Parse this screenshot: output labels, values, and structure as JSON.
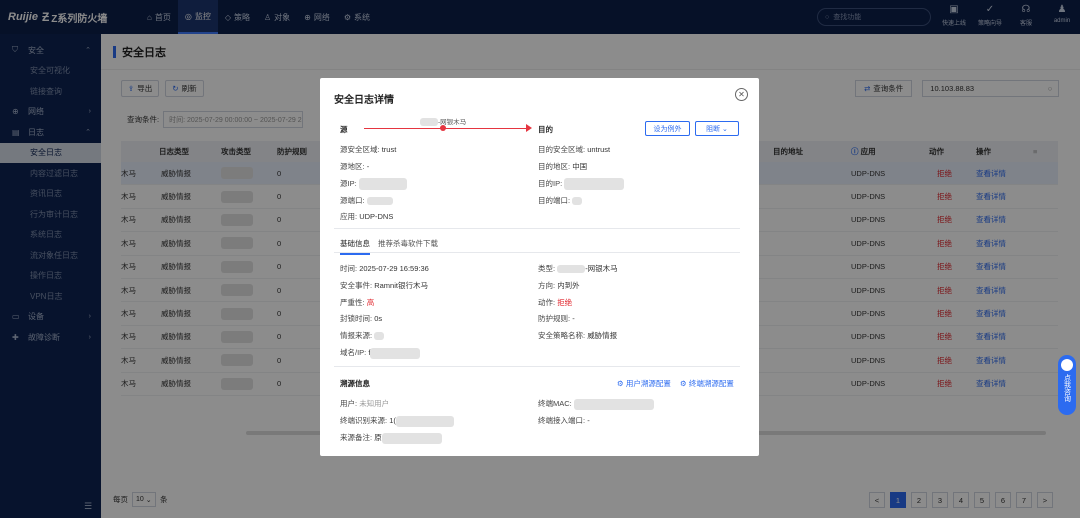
{
  "brand": {
    "logo": "Ruijie",
    "product": "Z系列防火墙"
  },
  "nav": [
    "首页",
    "监控",
    "策略",
    "对象",
    "网络",
    "系统"
  ],
  "search_placeholder": "查找功能",
  "tools": [
    "快速上线",
    "策略向导",
    "客服",
    "admin"
  ],
  "sidebar": {
    "groups": [
      {
        "label": "安全",
        "subs": [
          "安全可视化",
          "链接查询"
        ]
      },
      {
        "label": "网络"
      },
      {
        "label": "日志",
        "subs": [
          "安全日志",
          "内容过滤日志",
          "资讯日志",
          "行为审计日志",
          "系统日志",
          "流对象任日志",
          "操作日志",
          "VPN日志"
        ]
      },
      {
        "label": "设备"
      },
      {
        "label": "故障诊断"
      }
    ]
  },
  "page_title": "安全日志",
  "toolbar": {
    "export": "导出",
    "refresh": "刷新",
    "query": "查询条件",
    "ip": "10.103.88.83",
    "cond_label": "查询条件:",
    "cond_value": "时间: 2025-07-29 00:00:00 ~ 2025-07-29 23:59:59"
  },
  "table": {
    "headers": [
      "日志类型",
      "攻击类型",
      "防护规则",
      "目的地址",
      "应用",
      "动作",
      "操作"
    ],
    "rows": [
      {
        "prefix": "木马",
        "type": "威胁情报",
        "rule": "0",
        "app": "UDP-DNS",
        "action": "拒绝",
        "op": "查看详情"
      },
      {
        "prefix": "木马",
        "type": "威胁情报",
        "rule": "0",
        "app": "UDP-DNS",
        "action": "拒绝",
        "op": "查看详情"
      },
      {
        "prefix": "木马",
        "type": "威胁情报",
        "rule": "0",
        "app": "UDP-DNS",
        "action": "拒绝",
        "op": "查看详情"
      },
      {
        "prefix": "木马",
        "type": "威胁情报",
        "rule": "0",
        "app": "UDP-DNS",
        "action": "拒绝",
        "op": "查看详情"
      },
      {
        "prefix": "木马",
        "type": "威胁情报",
        "rule": "0",
        "app": "UDP-DNS",
        "action": "拒绝",
        "op": "查看详情"
      },
      {
        "prefix": "木马",
        "type": "威胁情报",
        "rule": "0",
        "app": "UDP-DNS",
        "action": "拒绝",
        "op": "查看详情"
      },
      {
        "prefix": "木马",
        "type": "威胁情报",
        "rule": "0",
        "app": "UDP-DNS",
        "action": "拒绝",
        "op": "查看详情"
      },
      {
        "prefix": "木马",
        "type": "威胁情报",
        "rule": "0",
        "app": "UDP-DNS",
        "action": "拒绝",
        "op": "查看详情"
      },
      {
        "prefix": "木马",
        "type": "威胁情报",
        "rule": "0",
        "app": "UDP-DNS",
        "action": "拒绝",
        "op": "查看详情"
      },
      {
        "prefix": "木马",
        "type": "威胁情报",
        "rule": "0",
        "app": "UDP-DNS",
        "action": "拒绝",
        "op": "查看详情"
      }
    ]
  },
  "pager": {
    "prefix": "每页",
    "size": "10",
    "suffix": "条",
    "pages": [
      "1",
      "2",
      "3",
      "4",
      "5",
      "6",
      "7"
    ],
    "prev": "<",
    "next": ">"
  },
  "help": "点我咨询",
  "modal": {
    "title": "安全日志详情",
    "src": "源",
    "dst": "目的",
    "flow_label": "-网银木马",
    "exclude_btn": "设为例外",
    "block_btn": "阻断 ⌄",
    "src_zone_k": "源安全区域:",
    "src_zone_v": "trust",
    "src_region_k": "源地区:",
    "src_region_v": "-",
    "src_ip_k": "源IP:",
    "src_port_k": "源端口:",
    "app_k": "应用:",
    "app_v": "UDP-DNS",
    "dst_zone_k": "目的安全区域:",
    "dst_zone_v": "untrust",
    "dst_region_k": "目的地区:",
    "dst_region_v": "中国",
    "dst_ip_k": "目的IP:",
    "dst_port_k": "目的端口:",
    "tab_basic": "基础信息",
    "tab_av": "推荐杀毒软件下载",
    "time_k": "时间:",
    "time_v": "2025-07-29 16:59:36",
    "event_k": "安全事件:",
    "event_v": "Ramnit银行木马",
    "severity_k": "严重性:",
    "severity_v": "高",
    "block_time_k": "封锁时间:",
    "block_time_v": "0s",
    "intel_k": "情报来源:",
    "domain_k": "域名/IP:",
    "domain_v": "f",
    "type_k": "类型:",
    "type_v": "-网银木马",
    "direction_k": "方向:",
    "direction_v": "内到外",
    "action_k": "动作:",
    "action_v": "拒绝",
    "rule_k": "防护规则:",
    "rule_v": "-",
    "policy_k": "安全策略名称:",
    "policy_v": "威胁情报",
    "trace_title": "溯源信息",
    "user_trace": "用户溯源配置",
    "term_trace": "终端溯源配置",
    "user_k": "用户:",
    "user_v": "未知用户",
    "term_id_k": "终端识别来源:",
    "term_id_v": "1(",
    "remark_k": "来源备注:",
    "remark_v": "原",
    "mac_k": "终端MAC:",
    "port_k": "终端接入端口:",
    "port_v": "-"
  }
}
